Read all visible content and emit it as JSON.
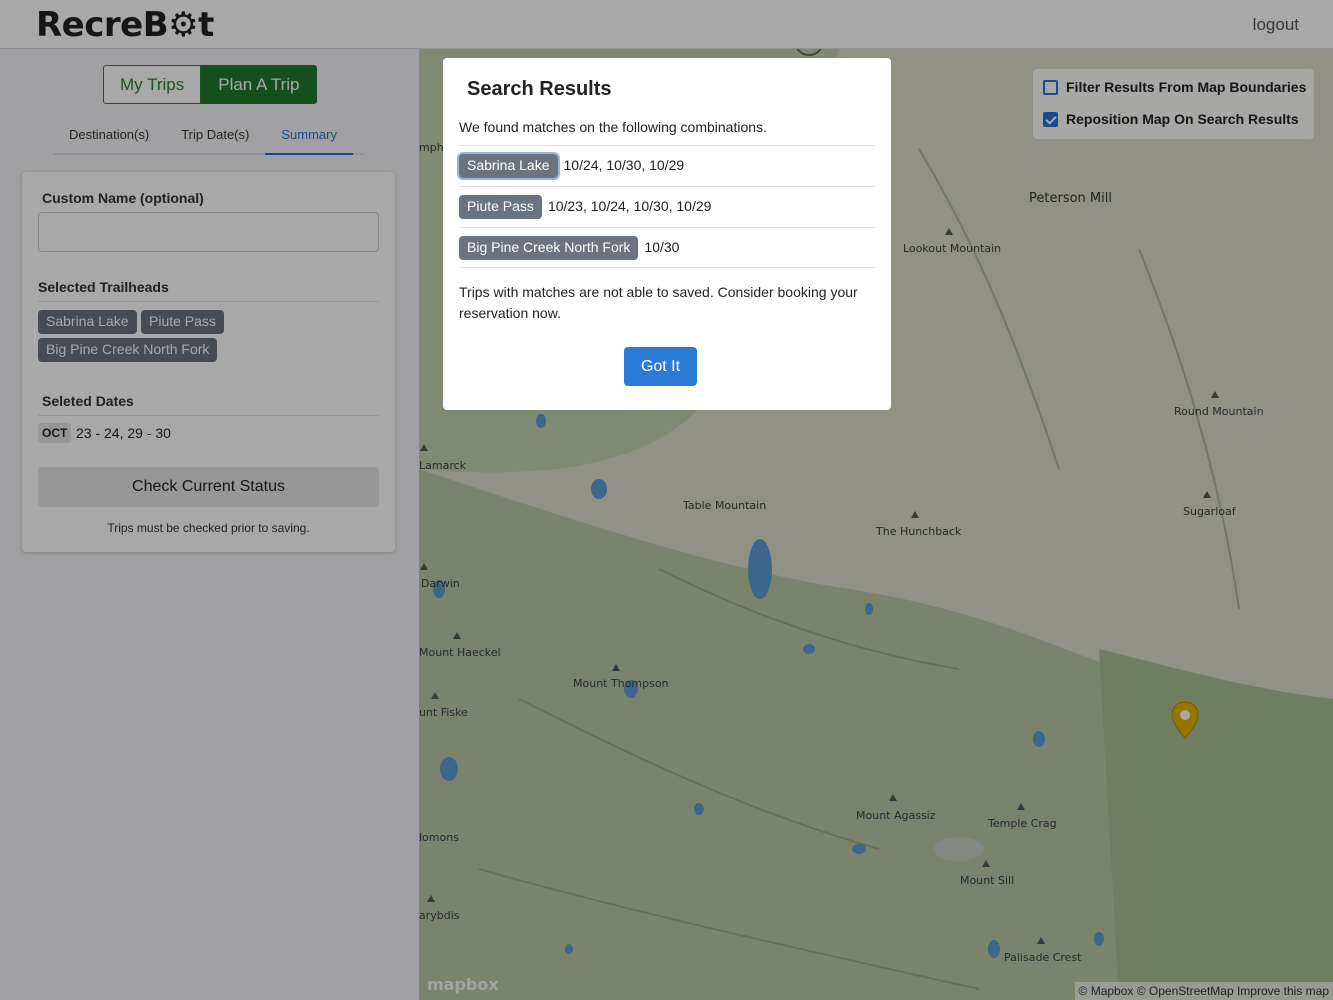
{
  "header": {
    "logo": "RecreB⚙t",
    "logout": "logout"
  },
  "sidebar": {
    "mode_buttons": [
      "My Trips",
      "Plan A Trip"
    ],
    "tabs": [
      "Destination(s)",
      "Trip Date(s)",
      "Summary"
    ],
    "active_tab": "Summary",
    "custom_name": {
      "label": "Custom Name (optional)",
      "value": "",
      "placeholder": ""
    },
    "trailheads": {
      "label": "Selected Trailheads",
      "items": [
        "Sabrina Lake",
        "Piute Pass",
        "Big Pine Creek North Fork"
      ]
    },
    "dates": {
      "label": "Seleted Dates",
      "month": "OCT",
      "range": "23 - 24, 29 - 30"
    },
    "check_button": "Check Current Status",
    "hint": "Trips must be checked prior to saving."
  },
  "map": {
    "controls": [
      {
        "label": "Filter Results From Map Boundaries",
        "checked": false
      },
      {
        "label": "Reposition Map On Search Results",
        "checked": true
      }
    ],
    "places": [
      "Peterson Mill",
      "Lookout Mountain",
      "Round Mountain",
      "Sugarloaf",
      "Lamarck",
      "Table Mountain",
      "The Hunchback",
      "Darwin",
      "Mount Haeckel",
      "Mount Thompson",
      "unt Fiske",
      "Mount Agassiz",
      "Temple Crag",
      "lomons",
      "Mount Sill",
      "arybdis",
      "Palisade Crest",
      "mphr"
    ],
    "logo": "mapbox",
    "attribution": "© Mapbox © OpenStreetMap Improve this map"
  },
  "modal": {
    "title": "Search Results",
    "intro": "We found matches on the following combinations.",
    "results": [
      {
        "trailhead": "Sabrina Lake",
        "dates": "10/24, 10/30, 10/29"
      },
      {
        "trailhead": "Piute Pass",
        "dates": "10/23, 10/24, 10/30, 10/29"
      },
      {
        "trailhead": "Big Pine Creek North Fork",
        "dates": "10/30"
      }
    ],
    "note": "Trips with matches are not able to saved. Consider booking your reservation now.",
    "button": "Got It"
  },
  "colors": {
    "primary": "#2a7bd5",
    "green": "#1e7a2e",
    "chip": "#6b7280",
    "pin": "#e5b400"
  }
}
